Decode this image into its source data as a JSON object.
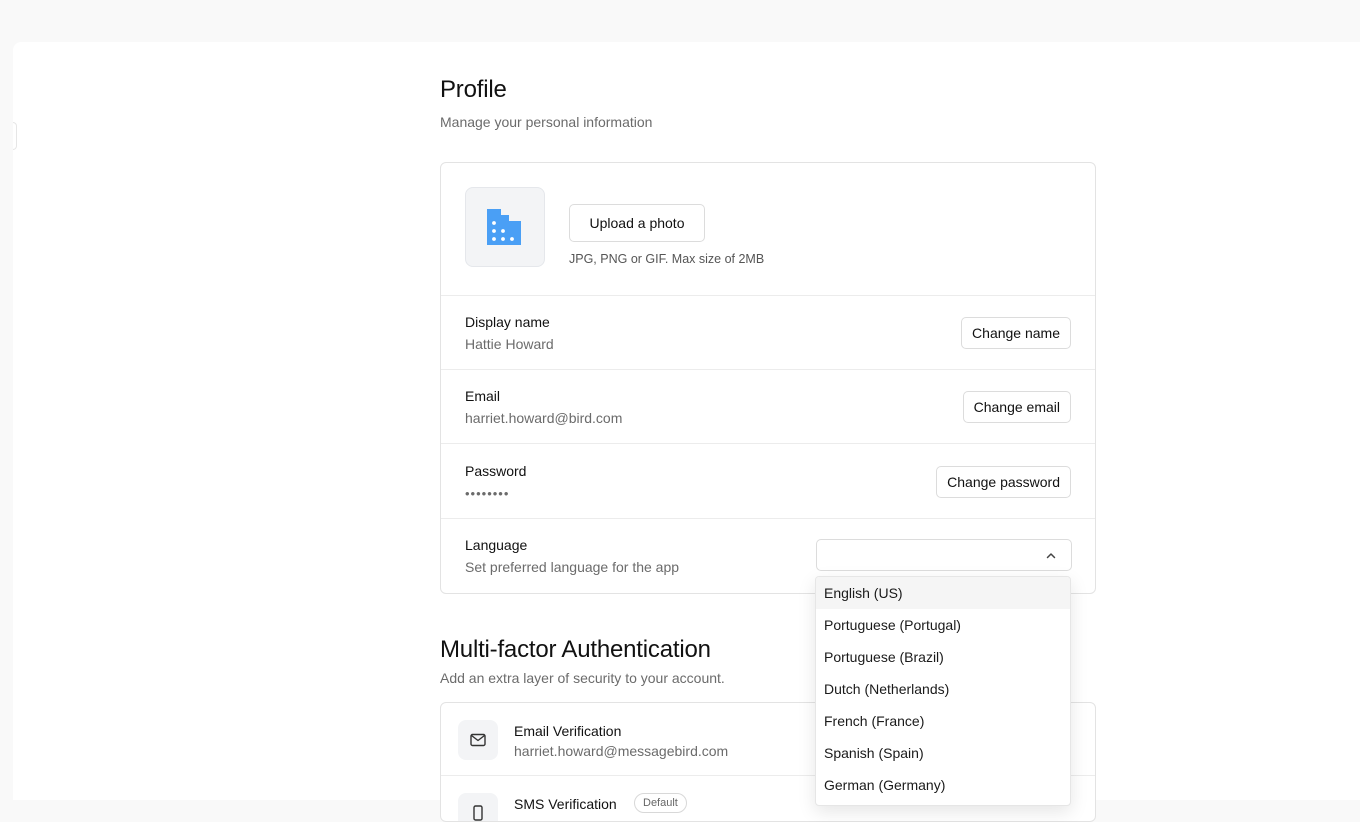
{
  "profile": {
    "title": "Profile",
    "subtitle": "Manage your personal information",
    "photo": {
      "upload_label": "Upload a photo",
      "hint": "JPG, PNG or GIF. Max size of 2MB"
    },
    "display_name": {
      "label": "Display name",
      "value": "Hattie Howard",
      "button": "Change name"
    },
    "email": {
      "label": "Email",
      "value": "harriet.howard@bird.com",
      "button": "Change email"
    },
    "password": {
      "label": "Password",
      "value": "••••••••",
      "button": "Change password"
    },
    "language": {
      "label": "Language",
      "description": "Set preferred language for the app",
      "selected": "",
      "options": [
        "English (US)",
        "Portuguese (Portugal)",
        "Portuguese (Brazil)",
        "Dutch (Netherlands)",
        "French (France)",
        "Spanish (Spain)",
        "German (Germany)"
      ],
      "highlighted_index": 0
    }
  },
  "mfa": {
    "title": "Multi-factor Authentication",
    "subtitle": "Add an extra layer of security to your account.",
    "methods": [
      {
        "title": "Email Verification",
        "detail": "harriet.howard@messagebird.com"
      },
      {
        "title": "SMS Verification",
        "badge": "Default"
      }
    ]
  },
  "colors": {
    "accent": "#4a9ff5",
    "text_primary": "#111111",
    "text_secondary": "#6b6b6b",
    "border": "#e3e3e3"
  }
}
